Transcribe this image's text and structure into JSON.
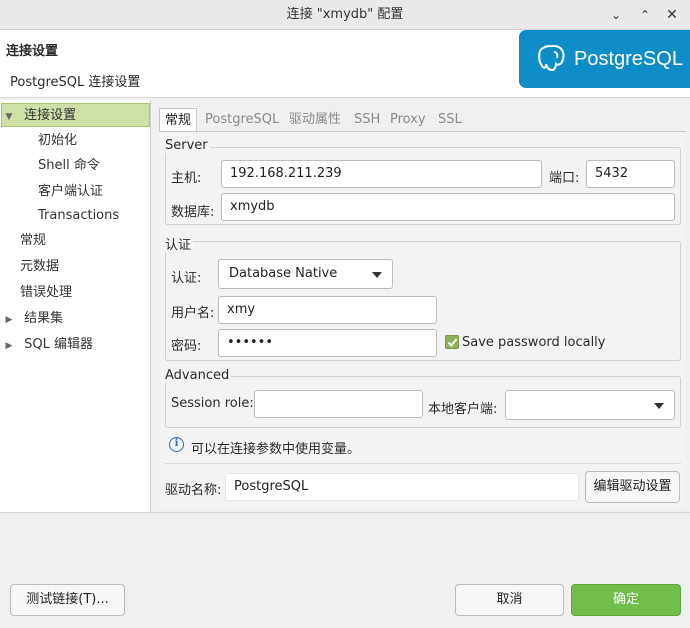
{
  "window": {
    "title": "连接 \"xmydb\" 配置",
    "buttons": [
      "minimize-icon",
      "restore-icon",
      "close-icon"
    ]
  },
  "header": {
    "title": "连接设置",
    "subtitle": "PostgreSQL 连接设置",
    "logo_text": "PostgreSQL"
  },
  "sidebar": {
    "items": [
      {
        "label": "连接设置",
        "expanded": true,
        "selected": true
      },
      {
        "label": "初始化"
      },
      {
        "label": "Shell 命令"
      },
      {
        "label": "客户端认证"
      },
      {
        "label": "Transactions"
      },
      {
        "label": "常规"
      },
      {
        "label": "元数据"
      },
      {
        "label": "错误处理"
      },
      {
        "label": "结果集",
        "expandable": true
      },
      {
        "label": "SQL 编辑器",
        "expandable": true
      }
    ]
  },
  "tabs": [
    "常规",
    "PostgreSQL",
    "驱动属性",
    "SSH",
    "Proxy",
    "SSL"
  ],
  "server": {
    "group_label": "Server",
    "host_label": "主机:",
    "host_value": "192.168.211.239",
    "port_label": "端口:",
    "port_value": "5432",
    "database_label": "数据库:",
    "database_value": "xmydb"
  },
  "auth": {
    "group_label": "认证",
    "auth_label": "认证:",
    "auth_value": "Database Native",
    "user_label": "用户名:",
    "user_value": "xmy",
    "password_label": "密码:",
    "password_value": "••••••",
    "save_password_label": "Save password locally",
    "save_password_checked": true
  },
  "advanced": {
    "group_label": "Advanced",
    "session_role_label": "Session role:",
    "session_role_value": "",
    "local_client_label": "本地客户端:",
    "local_client_value": ""
  },
  "info_text": "可以在连接参数中使用变量。",
  "driver": {
    "label": "驱动名称:",
    "value": "PostgreSQL",
    "edit_button": "编辑驱动设置"
  },
  "footer": {
    "test_button": "测试链接(T)...",
    "cancel_button": "取消",
    "ok_button": "确定"
  },
  "colors": {
    "accent_green": "#6fbf4a",
    "selection_green": "#cfe0a7",
    "logo_blue": "#0e8dc6"
  }
}
